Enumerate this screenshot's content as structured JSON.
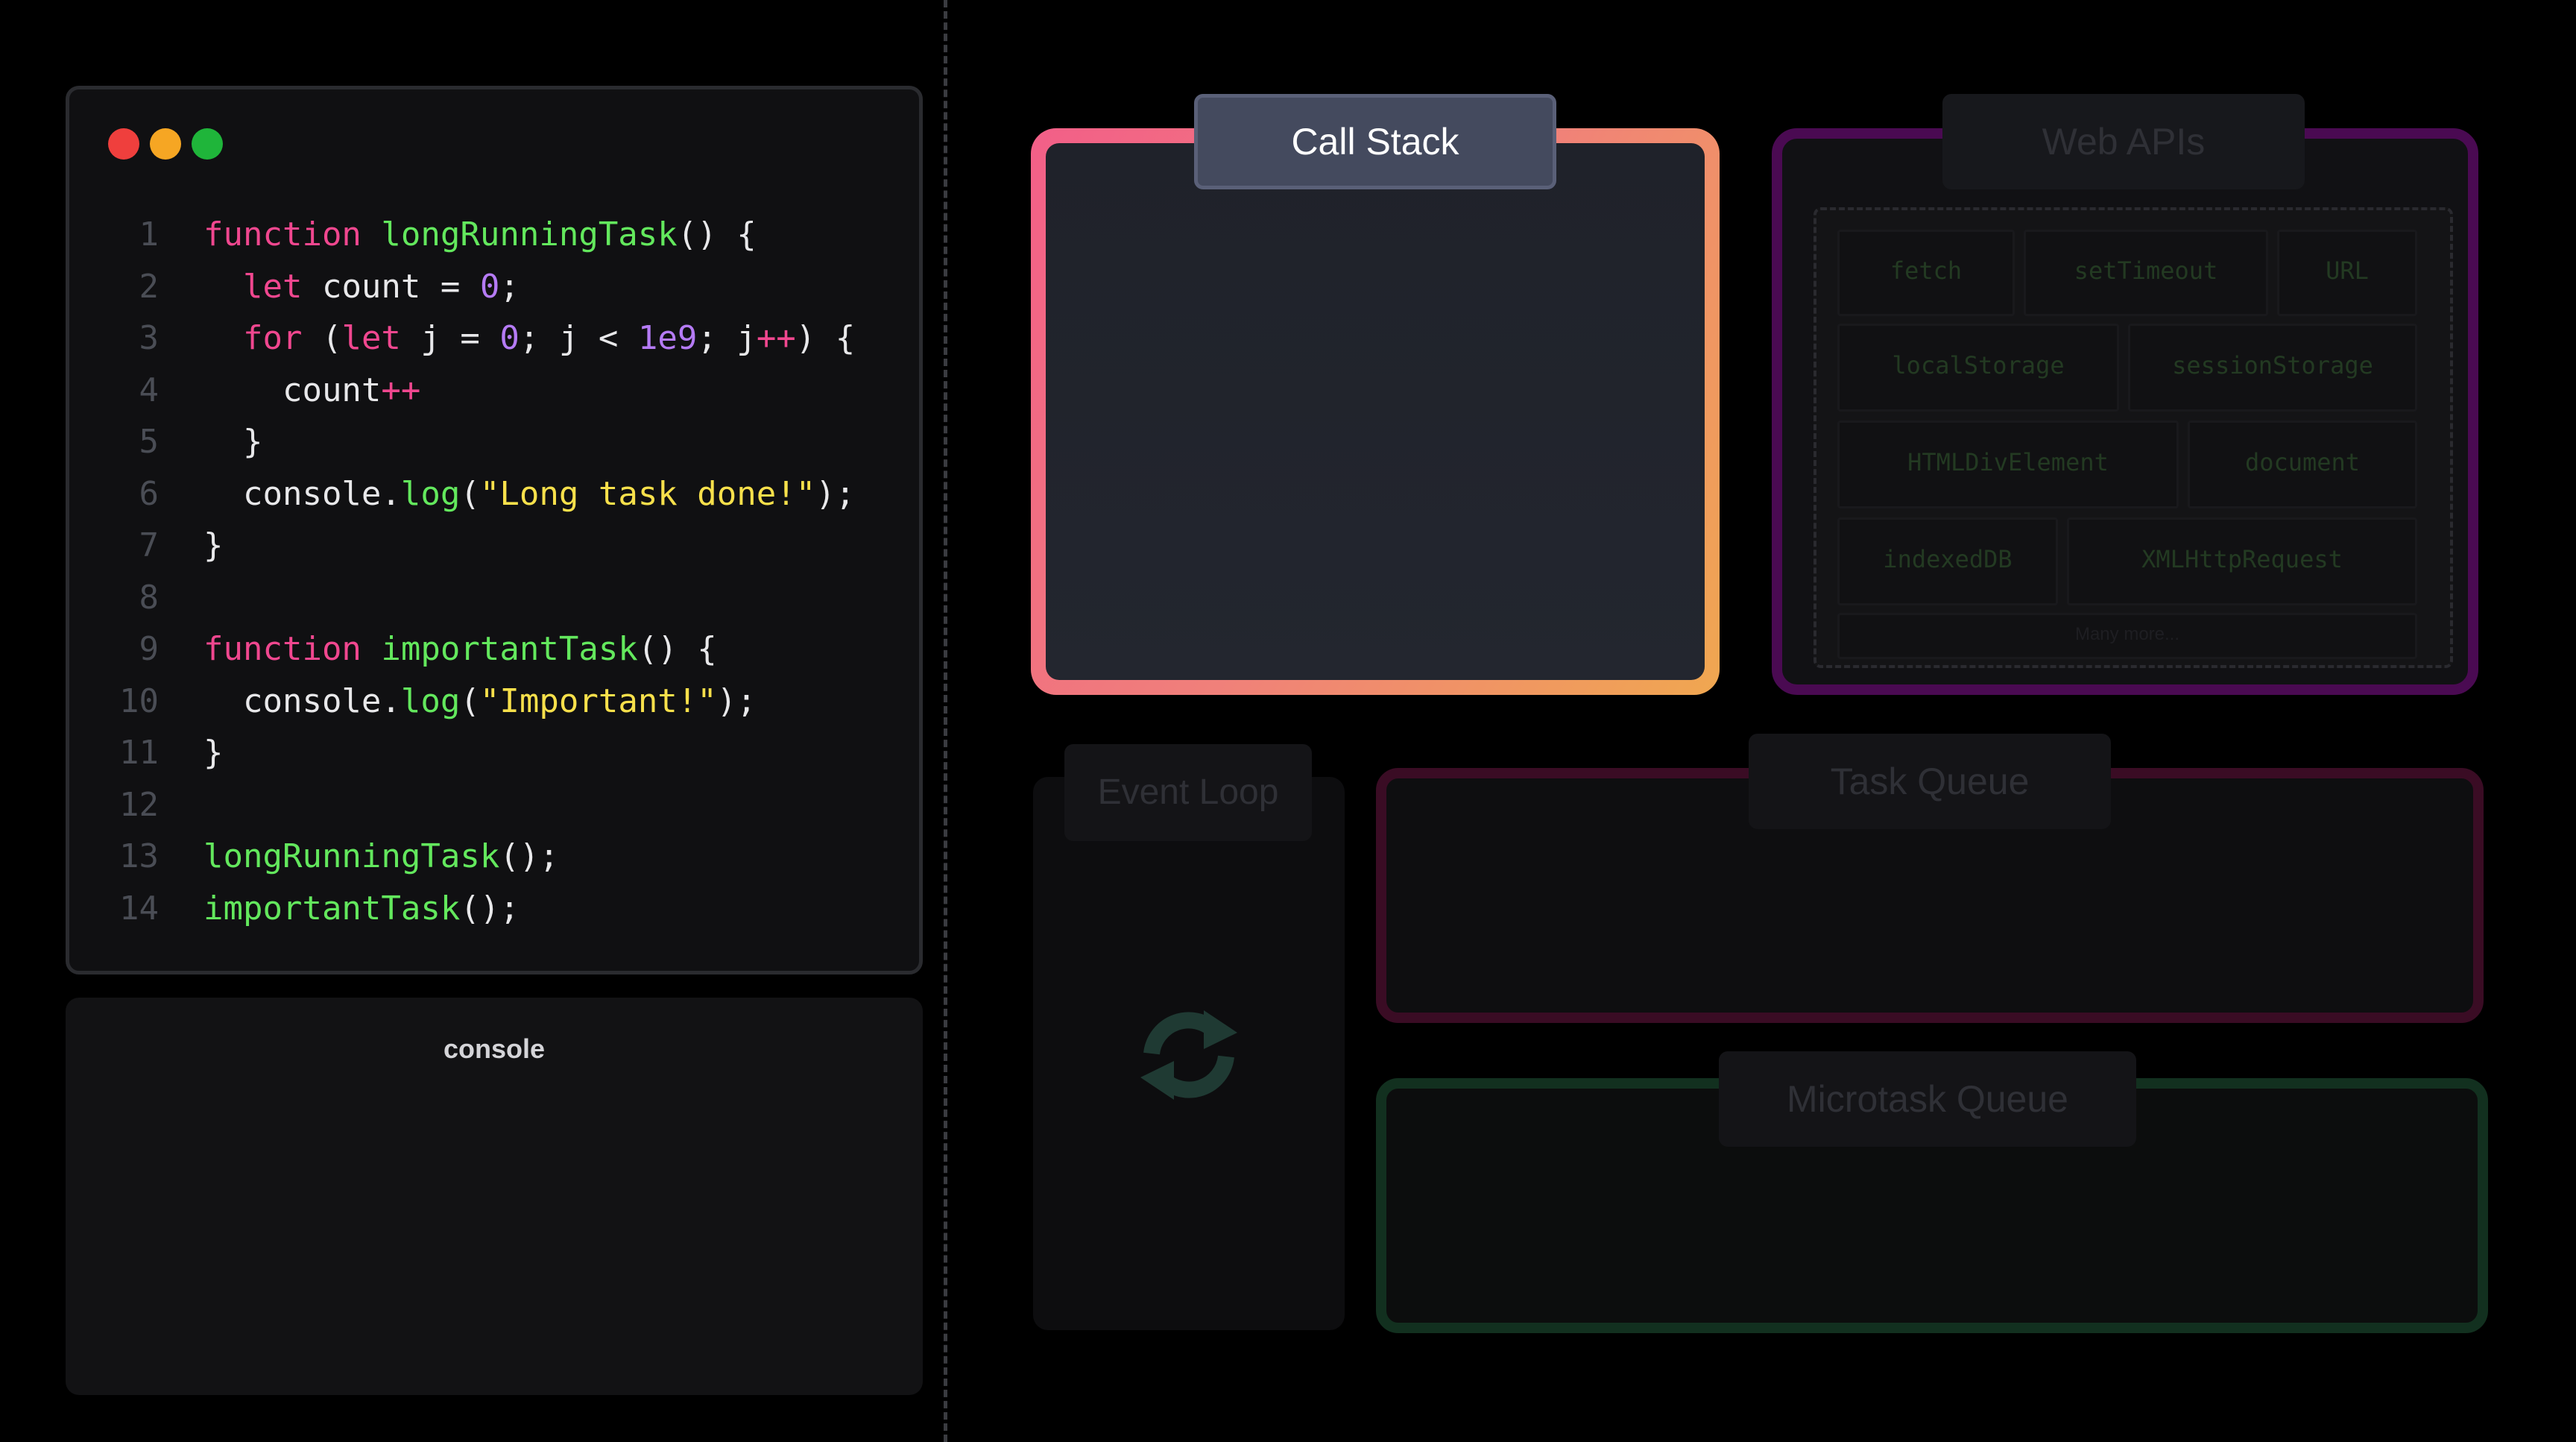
{
  "editor": {
    "lines": [
      {
        "n": "1"
      },
      {
        "n": "2"
      },
      {
        "n": "3"
      },
      {
        "n": "4"
      },
      {
        "n": "5"
      },
      {
        "n": "6"
      },
      {
        "n": "7"
      },
      {
        "n": "8"
      },
      {
        "n": "9"
      },
      {
        "n": "10"
      },
      {
        "n": "11"
      },
      {
        "n": "12"
      },
      {
        "n": "13"
      },
      {
        "n": "14"
      }
    ],
    "tokens": [
      [
        [
          "kw",
          "function "
        ],
        [
          "fn",
          "longRunningTask"
        ],
        [
          "plain",
          "() {"
        ]
      ],
      [
        [
          "plain",
          "  "
        ],
        [
          "kw",
          "let "
        ],
        [
          "plain",
          "count = "
        ],
        [
          "num",
          "0"
        ],
        [
          "plain",
          ";"
        ]
      ],
      [
        [
          "plain",
          "  "
        ],
        [
          "kw",
          "for "
        ],
        [
          "plain",
          "("
        ],
        [
          "kw",
          "let "
        ],
        [
          "plain",
          "j = "
        ],
        [
          "num",
          "0"
        ],
        [
          "plain",
          "; j < "
        ],
        [
          "num",
          "1e9"
        ],
        [
          "plain",
          "; j"
        ],
        [
          "op",
          "++"
        ],
        [
          "plain",
          ") {"
        ]
      ],
      [
        [
          "plain",
          "    count"
        ],
        [
          "op",
          "++"
        ]
      ],
      [
        [
          "plain",
          "  }"
        ]
      ],
      [
        [
          "plain",
          "  console."
        ],
        [
          "fn",
          "log"
        ],
        [
          "plain",
          "("
        ],
        [
          "str",
          "\"Long task done!\""
        ],
        [
          "plain",
          ");"
        ]
      ],
      [
        [
          "plain",
          "}"
        ]
      ],
      [],
      [
        [
          "kw",
          "function "
        ],
        [
          "fn",
          "importantTask"
        ],
        [
          "plain",
          "() {"
        ]
      ],
      [
        [
          "plain",
          "  console."
        ],
        [
          "fn",
          "log"
        ],
        [
          "plain",
          "("
        ],
        [
          "str",
          "\"Important!\""
        ],
        [
          "plain",
          ");"
        ]
      ],
      [
        [
          "plain",
          "}"
        ]
      ],
      [],
      [
        [
          "fn",
          "longRunningTask"
        ],
        [
          "plain",
          "();"
        ]
      ],
      [
        [
          "fn",
          "importantTask"
        ],
        [
          "plain",
          "();"
        ]
      ]
    ]
  },
  "console": {
    "title": "console"
  },
  "callstack": {
    "label": "Call Stack"
  },
  "webapis": {
    "label": "Web APIs",
    "items": [
      "fetch",
      "setTimeout",
      "URL",
      "localStorage",
      "sessionStorage",
      "HTMLDivElement",
      "document",
      "indexedDB",
      "XMLHttpRequest"
    ],
    "more": "Many more..."
  },
  "eventloop": {
    "label": "Event Loop"
  },
  "taskqueue": {
    "label": "Task Queue"
  },
  "microtaskqueue": {
    "label": "Microtask Queue"
  },
  "colors": {
    "keyword": "#f0478f",
    "function": "#63e85d",
    "number": "#b57bf5",
    "string": "#f7e04b",
    "callstack_gradient": [
      "#f25f88",
      "#f0a750"
    ],
    "webapis_border": "#4a0a52",
    "taskqueue_border": "#3a0c24",
    "microtask_border": "#12301f"
  }
}
